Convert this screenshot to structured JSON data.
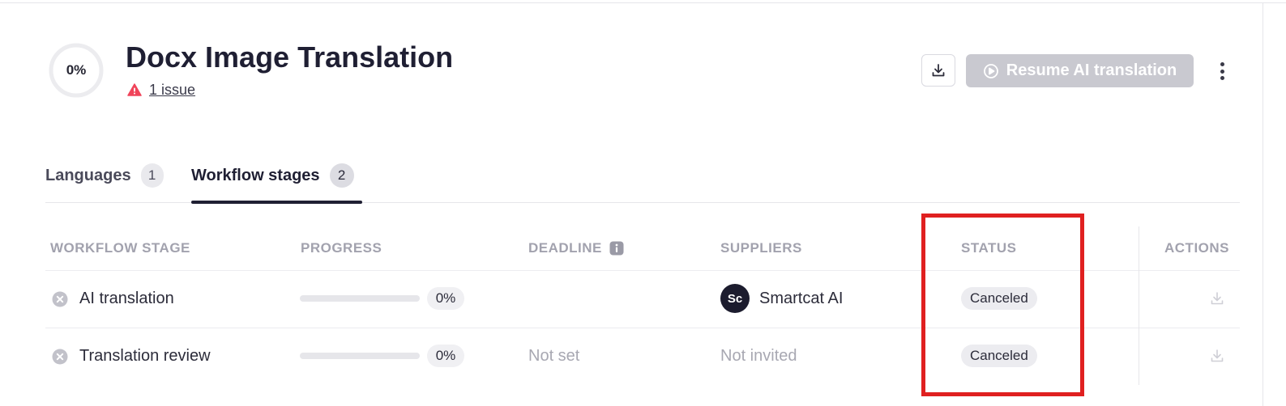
{
  "project": {
    "progress_label": "0%",
    "progress_value": 0,
    "title": "Docx Image Translation",
    "issue_label": "1 issue"
  },
  "toolbar": {
    "download_icon": "download-icon",
    "resume_label": "Resume AI translation",
    "resume_enabled": false,
    "more_icon": "vertical-ellipsis-icon"
  },
  "tabs": [
    {
      "label": "Languages",
      "count": "1",
      "active": false
    },
    {
      "label": "Workflow stages",
      "count": "2",
      "active": true
    }
  ],
  "table": {
    "headers": {
      "stage": "WORKFLOW STAGE",
      "progress": "PROGRESS",
      "deadline": "DEADLINE",
      "suppliers": "SUPPLIERS",
      "status": "STATUS",
      "actions": "ACTIONS"
    },
    "rows": [
      {
        "stage": "AI translation",
        "progress": "0%",
        "progress_value": 0,
        "deadline": "",
        "supplier": "Smartcat AI",
        "supplier_avatar": "Sc",
        "status": "Canceled"
      },
      {
        "stage": "Translation review",
        "progress": "0%",
        "progress_value": 0,
        "deadline": "Not set",
        "supplier": "Not invited",
        "status": "Canceled"
      }
    ]
  },
  "colors": {
    "accent_text": "#1f1f33",
    "issue_warning": "#f0445a",
    "disabled_button": "#c9c9d0",
    "highlight": "#e02020"
  }
}
